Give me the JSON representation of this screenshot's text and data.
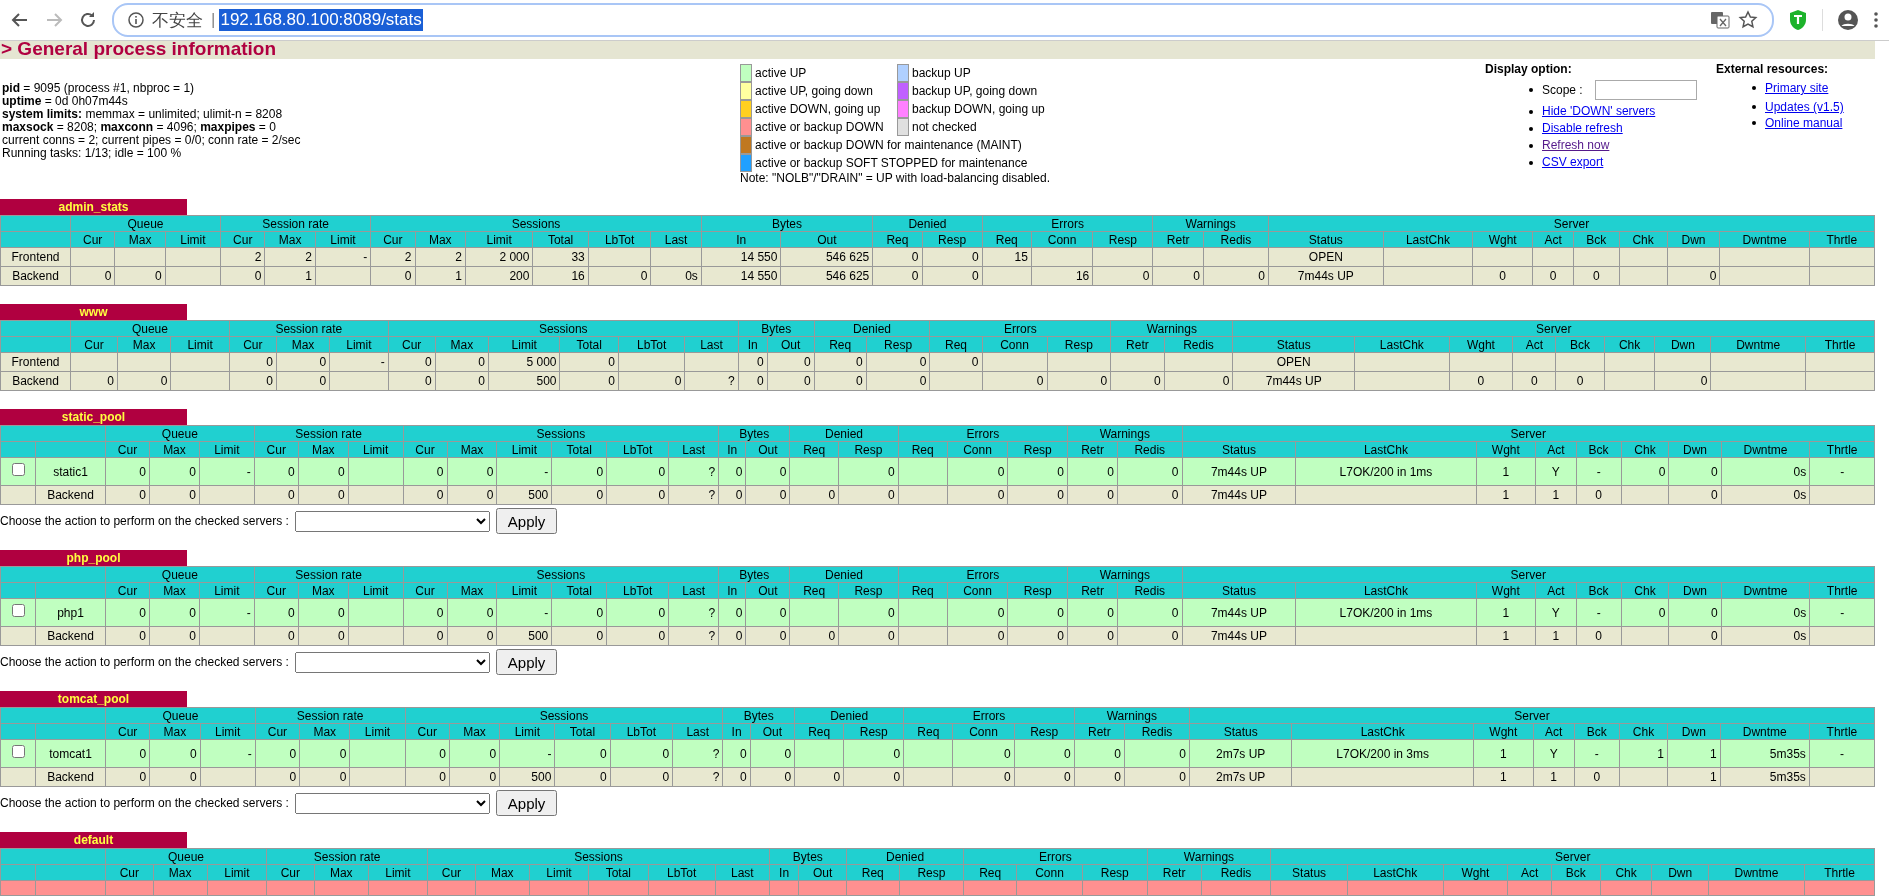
{
  "browser": {
    "back_disabled": false,
    "forward_disabled": true,
    "security_label": "不安全",
    "separator": "|",
    "url": "192.168.80.100:8089/stats",
    "url_selected": true
  },
  "header": {
    "title": "> General process information"
  },
  "info": {
    "lines": [
      "**pid** = 9095 (process #1, nbproc = 1)",
      "**uptime** = 0d 0h07m44s",
      "**system limits:** memmax = unlimited; ulimit-n = 8208",
      "**maxsock** = 8208; **maxconn** = 4096; **maxpipes** = 0",
      "current conns = 2; current pipes = 0/0; conn rate = 2/sec",
      "Running tasks: 1/13; idle = 100 %"
    ]
  },
  "legend": {
    "rows": [
      [
        {
          "label": "active UP",
          "color": "#c0ffc0"
        },
        {
          "label": "backup UP",
          "color": "#b0d0ff"
        }
      ],
      [
        {
          "label": "active UP, going down",
          "color": "#ffffa0"
        },
        {
          "label": "backup UP, going down",
          "color": "#c060ff"
        }
      ],
      [
        {
          "label": "active DOWN, going up",
          "color": "#ffd020"
        },
        {
          "label": "backup DOWN, going up",
          "color": "#ff80ff"
        }
      ],
      [
        {
          "label": "active or backup DOWN",
          "color": "#ff9090"
        },
        {
          "label": "not checked",
          "color": "#e0e0e0"
        }
      ],
      [
        {
          "label": "active or backup DOWN for maintenance (MAINT)",
          "color": "#c07820"
        }
      ],
      [
        {
          "label": "active or backup SOFT STOPPED for maintenance",
          "color": "#20a0ff"
        }
      ]
    ],
    "note": "Note: \"NOLB\"/\"DRAIN\" = UP with load-balancing disabled."
  },
  "display_options": {
    "title": "Display option:",
    "scope_label": "Scope :",
    "links": [
      {
        "label": "Hide 'DOWN' servers",
        "visited": false
      },
      {
        "label": "Disable refresh",
        "visited": false
      },
      {
        "label": "Refresh now",
        "visited": true
      },
      {
        "label": "CSV export",
        "visited": false
      }
    ]
  },
  "external_resources": {
    "title": "External resources:",
    "links": [
      {
        "label": "Primary site",
        "visited": false
      },
      {
        "label": "Updates (v1.5)",
        "visited": false
      },
      {
        "label": "Online manual",
        "visited": false
      }
    ]
  },
  "proxies": [
    {
      "name": "admin_stats",
      "selectable": false,
      "column_groups": [
        {
          "label": "Queue",
          "columns": [
            "Cur",
            "Max",
            "Limit"
          ]
        },
        {
          "label": "Session rate",
          "columns": [
            "Cur",
            "Max",
            "Limit"
          ]
        },
        {
          "label": "Sessions",
          "columns": [
            "Cur",
            "Max",
            "Limit",
            "Total",
            "LbTot",
            "Last"
          ]
        },
        {
          "label": "Bytes",
          "columns": [
            "In",
            "Out"
          ]
        },
        {
          "label": "Denied",
          "columns": [
            "Req",
            "Resp"
          ]
        },
        {
          "label": "Errors",
          "columns": [
            "Req",
            "Conn",
            "Resp"
          ]
        },
        {
          "label": "Warnings",
          "columns": [
            "Retr",
            "Redis"
          ]
        },
        {
          "label": "Server",
          "columns": [
            "Status",
            "LastChk",
            "Wght",
            "Act",
            "Bck",
            "Chk",
            "Dwn",
            "Dwntme",
            "Thrtle"
          ]
        }
      ],
      "rows": [
        {
          "kind": "frontend",
          "color": "#e8e8d0",
          "cells": [
            "Frontend",
            null,
            null,
            null,
            "2",
            "2",
            "-",
            "2",
            "2",
            "2 000",
            "33",
            null,
            null,
            "14 550",
            "546 625",
            "0",
            "0",
            "15",
            null,
            null,
            null,
            null,
            "OPEN",
            null,
            null,
            null,
            null,
            null,
            null,
            null,
            null
          ]
        },
        {
          "kind": "backend",
          "color": "#e8e8d0",
          "cells": [
            "Backend",
            "0",
            "0",
            null,
            "0",
            "1",
            null,
            "0",
            "1",
            "200",
            "16",
            "0",
            "0s",
            "14 550",
            "546 625",
            "0",
            "0",
            null,
            "16",
            "0",
            "0",
            "0",
            "7m44s UP",
            null,
            "0",
            "0",
            "0",
            null,
            "0",
            null,
            null
          ]
        }
      ]
    },
    {
      "name": "www",
      "selectable": false,
      "column_groups": [
        {
          "label": "Queue",
          "columns": [
            "Cur",
            "Max",
            "Limit"
          ]
        },
        {
          "label": "Session rate",
          "columns": [
            "Cur",
            "Max",
            "Limit"
          ]
        },
        {
          "label": "Sessions",
          "columns": [
            "Cur",
            "Max",
            "Limit",
            "Total",
            "LbTot",
            "Last"
          ]
        },
        {
          "label": "Bytes",
          "columns": [
            "In",
            "Out"
          ]
        },
        {
          "label": "Denied",
          "columns": [
            "Req",
            "Resp"
          ]
        },
        {
          "label": "Errors",
          "columns": [
            "Req",
            "Conn",
            "Resp"
          ]
        },
        {
          "label": "Warnings",
          "columns": [
            "Retr",
            "Redis"
          ]
        },
        {
          "label": "Server",
          "columns": [
            "Status",
            "LastChk",
            "Wght",
            "Act",
            "Bck",
            "Chk",
            "Dwn",
            "Dwntme",
            "Thrtle"
          ]
        }
      ],
      "rows": [
        {
          "kind": "frontend",
          "color": "#e8e8d0",
          "cells": [
            "Frontend",
            null,
            null,
            null,
            "0",
            "0",
            "-",
            "0",
            "0",
            "5 000",
            "0",
            null,
            null,
            "0",
            "0",
            "0",
            "0",
            "0",
            null,
            null,
            null,
            null,
            "OPEN",
            null,
            null,
            null,
            null,
            null,
            null,
            null,
            null
          ]
        },
        {
          "kind": "backend",
          "color": "#e8e8d0",
          "cells": [
            "Backend",
            "0",
            "0",
            null,
            "0",
            "0",
            null,
            "0",
            "0",
            "500",
            "0",
            "0",
            "?",
            "0",
            "0",
            "0",
            "0",
            null,
            "0",
            "0",
            "0",
            "0",
            "7m44s UP",
            null,
            "0",
            "0",
            "0",
            null,
            "0",
            null,
            null
          ]
        }
      ]
    },
    {
      "name": "static_pool",
      "selectable": true,
      "column_groups": [
        {
          "label": "Queue",
          "columns": [
            "Cur",
            "Max",
            "Limit"
          ]
        },
        {
          "label": "Session rate",
          "columns": [
            "Cur",
            "Max",
            "Limit"
          ]
        },
        {
          "label": "Sessions",
          "columns": [
            "Cur",
            "Max",
            "Limit",
            "Total",
            "LbTot",
            "Last"
          ]
        },
        {
          "label": "Bytes",
          "columns": [
            "In",
            "Out"
          ]
        },
        {
          "label": "Denied",
          "columns": [
            "Req",
            "Resp"
          ]
        },
        {
          "label": "Errors",
          "columns": [
            "Req",
            "Conn",
            "Resp"
          ]
        },
        {
          "label": "Warnings",
          "columns": [
            "Retr",
            "Redis"
          ]
        },
        {
          "label": "Server",
          "columns": [
            "Status",
            "LastChk",
            "Wght",
            "Act",
            "Bck",
            "Chk",
            "Dwn",
            "Dwntme",
            "Thrtle"
          ]
        }
      ],
      "rows": [
        {
          "kind": "server",
          "color": "#c0ffc0",
          "checked": false,
          "cells": [
            "static1",
            "0",
            "0",
            "-",
            "0",
            "0",
            null,
            "0",
            "0",
            "-",
            "0",
            "0",
            "?",
            "0",
            "0",
            null,
            "0",
            null,
            "0",
            "0",
            "0",
            "0",
            "7m44s UP",
            "L7OK/200 in 1ms",
            "1",
            "Y",
            "-",
            "0",
            "0",
            "0s",
            "-"
          ]
        },
        {
          "kind": "backend",
          "color": "#e8e8d0",
          "cells": [
            "Backend",
            "0",
            "0",
            null,
            "0",
            "0",
            null,
            "0",
            "0",
            "500",
            "0",
            "0",
            "?",
            "0",
            "0",
            "0",
            "0",
            null,
            "0",
            "0",
            "0",
            "0",
            "7m44s UP",
            null,
            "1",
            "1",
            "0",
            null,
            "0",
            "0s",
            null
          ]
        }
      ],
      "action": {
        "label": "Choose the action to perform on the checked servers :",
        "button": "Apply"
      }
    },
    {
      "name": "php_pool",
      "selectable": true,
      "column_groups": [
        {
          "label": "Queue",
          "columns": [
            "Cur",
            "Max",
            "Limit"
          ]
        },
        {
          "label": "Session rate",
          "columns": [
            "Cur",
            "Max",
            "Limit"
          ]
        },
        {
          "label": "Sessions",
          "columns": [
            "Cur",
            "Max",
            "Limit",
            "Total",
            "LbTot",
            "Last"
          ]
        },
        {
          "label": "Bytes",
          "columns": [
            "In",
            "Out"
          ]
        },
        {
          "label": "Denied",
          "columns": [
            "Req",
            "Resp"
          ]
        },
        {
          "label": "Errors",
          "columns": [
            "Req",
            "Conn",
            "Resp"
          ]
        },
        {
          "label": "Warnings",
          "columns": [
            "Retr",
            "Redis"
          ]
        },
        {
          "label": "Server",
          "columns": [
            "Status",
            "LastChk",
            "Wght",
            "Act",
            "Bck",
            "Chk",
            "Dwn",
            "Dwntme",
            "Thrtle"
          ]
        }
      ],
      "rows": [
        {
          "kind": "server",
          "color": "#c0ffc0",
          "checked": false,
          "cells": [
            "php1",
            "0",
            "0",
            "-",
            "0",
            "0",
            null,
            "0",
            "0",
            "-",
            "0",
            "0",
            "?",
            "0",
            "0",
            null,
            "0",
            null,
            "0",
            "0",
            "0",
            "0",
            "7m44s UP",
            "L7OK/200 in 1ms",
            "1",
            "Y",
            "-",
            "0",
            "0",
            "0s",
            "-"
          ]
        },
        {
          "kind": "backend",
          "color": "#e8e8d0",
          "cells": [
            "Backend",
            "0",
            "0",
            null,
            "0",
            "0",
            null,
            "0",
            "0",
            "500",
            "0",
            "0",
            "?",
            "0",
            "0",
            "0",
            "0",
            null,
            "0",
            "0",
            "0",
            "0",
            "7m44s UP",
            null,
            "1",
            "1",
            "0",
            null,
            "0",
            "0s",
            null
          ]
        }
      ],
      "action": {
        "label": "Choose the action to perform on the checked servers :",
        "button": "Apply"
      }
    },
    {
      "name": "tomcat_pool",
      "selectable": true,
      "column_groups": [
        {
          "label": "Queue",
          "columns": [
            "Cur",
            "Max",
            "Limit"
          ]
        },
        {
          "label": "Session rate",
          "columns": [
            "Cur",
            "Max",
            "Limit"
          ]
        },
        {
          "label": "Sessions",
          "columns": [
            "Cur",
            "Max",
            "Limit",
            "Total",
            "LbTot",
            "Last"
          ]
        },
        {
          "label": "Bytes",
          "columns": [
            "In",
            "Out"
          ]
        },
        {
          "label": "Denied",
          "columns": [
            "Req",
            "Resp"
          ]
        },
        {
          "label": "Errors",
          "columns": [
            "Req",
            "Conn",
            "Resp"
          ]
        },
        {
          "label": "Warnings",
          "columns": [
            "Retr",
            "Redis"
          ]
        },
        {
          "label": "Server",
          "columns": [
            "Status",
            "LastChk",
            "Wght",
            "Act",
            "Bck",
            "Chk",
            "Dwn",
            "Dwntme",
            "Thrtle"
          ]
        }
      ],
      "rows": [
        {
          "kind": "server",
          "color": "#c0ffc0",
          "checked": false,
          "cells": [
            "tomcat1",
            "0",
            "0",
            "-",
            "0",
            "0",
            null,
            "0",
            "0",
            "-",
            "0",
            "0",
            "?",
            "0",
            "0",
            null,
            "0",
            null,
            "0",
            "0",
            "0",
            "0",
            "2m7s UP",
            "L7OK/200 in 3ms",
            "1",
            "Y",
            "-",
            "1",
            "1",
            "5m35s",
            "-"
          ]
        },
        {
          "kind": "backend",
          "color": "#e8e8d0",
          "cells": [
            "Backend",
            "0",
            "0",
            null,
            "0",
            "0",
            null,
            "0",
            "0",
            "500",
            "0",
            "0",
            "?",
            "0",
            "0",
            "0",
            "0",
            null,
            "0",
            "0",
            "0",
            "0",
            "2m7s UP",
            null,
            "1",
            "1",
            "0",
            null,
            "1",
            "5m35s",
            null
          ]
        }
      ],
      "action": {
        "label": "Choose the action to perform on the checked servers :",
        "button": "Apply"
      }
    },
    {
      "name": "default",
      "selectable": true,
      "column_groups": [
        {
          "label": "Queue",
          "columns": [
            "Cur",
            "Max",
            "Limit"
          ]
        },
        {
          "label": "Session rate",
          "columns": [
            "Cur",
            "Max",
            "Limit"
          ]
        },
        {
          "label": "Sessions",
          "columns": [
            "Cur",
            "Max",
            "Limit",
            "Total",
            "LbTot",
            "Last"
          ]
        },
        {
          "label": "Bytes",
          "columns": [
            "In",
            "Out"
          ]
        },
        {
          "label": "Denied",
          "columns": [
            "Req",
            "Resp"
          ]
        },
        {
          "label": "Errors",
          "columns": [
            "Req",
            "Conn",
            "Resp"
          ]
        },
        {
          "label": "Warnings",
          "columns": [
            "Retr",
            "Redis"
          ]
        },
        {
          "label": "Server",
          "columns": [
            "Status",
            "LastChk",
            "Wght",
            "Act",
            "Bck",
            "Chk",
            "Dwn",
            "Dwntme",
            "Thrtle"
          ]
        }
      ],
      "rows": [
        {
          "kind": "cut",
          "color": "#ff9090"
        }
      ]
    }
  ]
}
